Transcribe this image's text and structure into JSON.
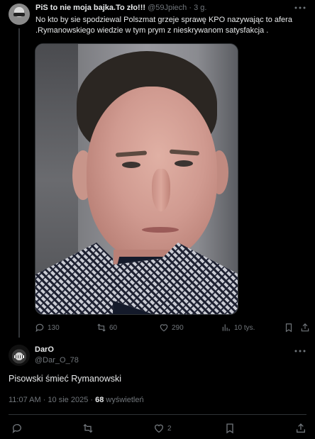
{
  "parent_tweet": {
    "author_name": "PiS to nie moja bajka.To zło!!!",
    "handle": "@59Jpiech",
    "separator": "·",
    "time": "3 g.",
    "text": "No kto by sie spodziewal Polszmat grzeje sprawę KPO nazywając to afera .Rymanowskiego wiedzie w tym prym z nieskrywanom satysfakcja .",
    "actions": {
      "replies": "130",
      "reposts": "60",
      "likes": "290",
      "views": "10 tys."
    }
  },
  "reply_tweet": {
    "author_name": "DarO",
    "handle": "@Dar_O_78",
    "text": "Pisowski śmieć Rymanowski",
    "time": "11:07 AM · 10 sie 2025 ·",
    "views_count": "68",
    "views_label": "wyświetleń",
    "actions": {
      "likes": "2"
    }
  },
  "icons": [
    "more-icon",
    "reply-icon",
    "repost-icon",
    "like-icon",
    "views-icon",
    "bookmark-icon",
    "share-icon"
  ],
  "colors": {
    "background": "#000000",
    "text": "#e7e9ea",
    "muted": "#71767b",
    "divider": "#2f3336"
  }
}
